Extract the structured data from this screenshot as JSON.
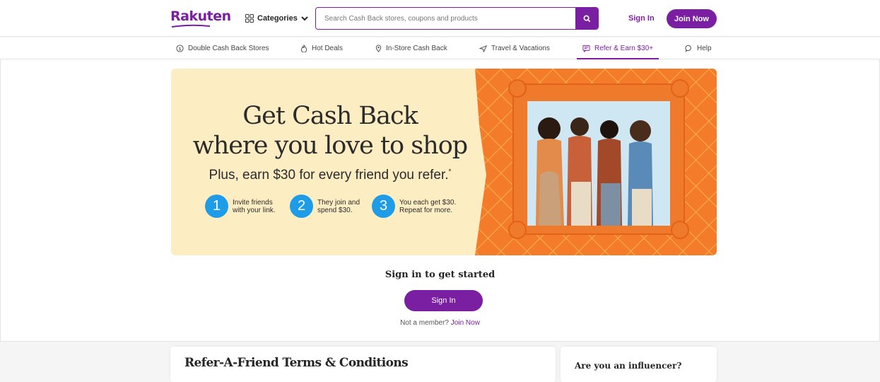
{
  "header": {
    "logo": "Rakuten",
    "categories_label": "Categories",
    "search_placeholder": "Search Cash Back stores, coupons and products",
    "signin_label": "Sign In",
    "join_label": "Join Now"
  },
  "nav": {
    "items": [
      {
        "label": "Double Cash Back Stores",
        "icon": "dollar-circle-icon"
      },
      {
        "label": "Hot Deals",
        "icon": "flame-icon"
      },
      {
        "label": "In-Store Cash Back",
        "icon": "map-pin-icon"
      },
      {
        "label": "Travel & Vacations",
        "icon": "plane-icon"
      },
      {
        "label": "Refer & Earn $30+",
        "icon": "chat-referral-icon",
        "active": true
      },
      {
        "label": "Help",
        "icon": "help-bubble-icon"
      }
    ]
  },
  "hero": {
    "title_line1": "Get Cash Back",
    "title_line2": "where you love to shop",
    "subtitle": "Plus, earn $30 for every friend you refer.",
    "subtitle_mark": "*",
    "steps": [
      {
        "num": "1",
        "line1": "Invite friends",
        "line2": "with your link."
      },
      {
        "num": "2",
        "line1": "They join and",
        "line2": "spend $30."
      },
      {
        "num": "3",
        "line1": "You each get $30.",
        "line2": "Repeat for more."
      }
    ]
  },
  "signin_section": {
    "heading": "Sign in to get started",
    "button_label": "Sign In",
    "not_member": "Not a member?",
    "join_link": "Join Now"
  },
  "cards": {
    "terms_title": "Refer-A-Friend Terms & Conditions",
    "influencer_title": "Are you an influencer?"
  },
  "colors": {
    "brand_purple": "#7b1fa2",
    "step_blue": "#1e9ce8",
    "hero_cream": "#fdedc3",
    "hero_orange": "#f47b2a"
  }
}
